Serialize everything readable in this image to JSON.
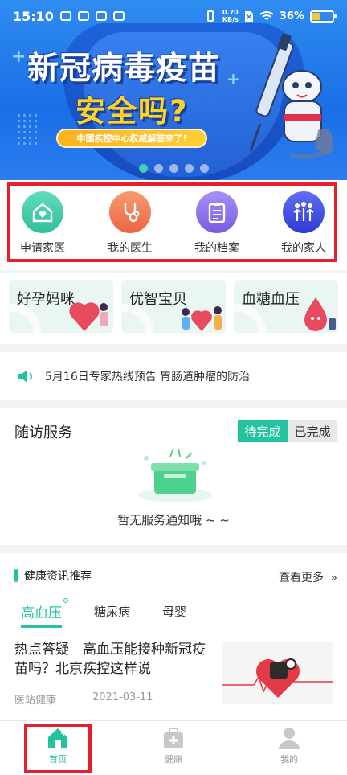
{
  "status_bar": {
    "time": "15:10",
    "net_speed_value": "0.70",
    "net_speed_unit": "KB/s",
    "battery": "36%",
    "battery_level": 0.36
  },
  "banner": {
    "title_line1": "新冠病毒疫苗",
    "title_line2": "安全吗?",
    "tagline": "中国疾控中心权威解答来了!",
    "page_count": 5,
    "active_page": 1
  },
  "quick_nav": [
    {
      "label": "申请家医",
      "icon": "home-heart-icon",
      "color": "#3cc7a5"
    },
    {
      "label": "我的医生",
      "icon": "stethoscope-icon",
      "color": "#f07a55"
    },
    {
      "label": "我的档案",
      "icon": "clipboard-icon",
      "color": "#8a6be8"
    },
    {
      "label": "我的家人",
      "icon": "family-icon",
      "color": "#3f4ee0"
    }
  ],
  "categories": [
    {
      "label": "好孕妈咪"
    },
    {
      "label": "优智宝贝"
    },
    {
      "label": "血糖血压"
    }
  ],
  "notice": {
    "icon": "speaker-icon",
    "text": "5月16日专家热线预告 胃肠道肿瘤的防治"
  },
  "followup": {
    "title": "随访服务",
    "tab_pending": "待完成",
    "tab_done": "已完成",
    "empty_text": "暂无服务通知哦 ~ ~"
  },
  "news": {
    "title": "健康资讯推荐",
    "more": "查看更多",
    "tabs": [
      "高血压",
      "糖尿病",
      "母婴"
    ],
    "article": {
      "title": "热点答疑｜高血压能接种新冠疫苗吗？北京疾控这样说",
      "source": "医站健康",
      "date": "2021-03-11"
    }
  },
  "bottom_nav": [
    {
      "label": "首页",
      "icon": "home-icon",
      "active": true
    },
    {
      "label": "健康",
      "icon": "medkit-icon",
      "active": false
    },
    {
      "label": "我的",
      "icon": "user-icon",
      "active": false
    }
  ],
  "colors": {
    "accent": "#23c3a0",
    "highlight": "#e4202c",
    "banner_blue": "#1a6fe6"
  }
}
